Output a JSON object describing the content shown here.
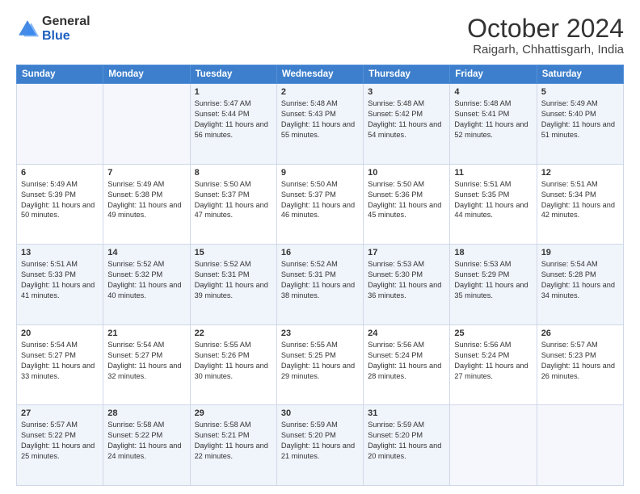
{
  "logo": {
    "general": "General",
    "blue": "Blue"
  },
  "header": {
    "month": "October 2024",
    "location": "Raigarh, Chhattisgarh, India"
  },
  "weekdays": [
    "Sunday",
    "Monday",
    "Tuesday",
    "Wednesday",
    "Thursday",
    "Friday",
    "Saturday"
  ],
  "weeks": [
    [
      {
        "day": "",
        "empty": true
      },
      {
        "day": "",
        "empty": true
      },
      {
        "day": "1",
        "sunrise": "Sunrise: 5:47 AM",
        "sunset": "Sunset: 5:44 PM",
        "daylight": "Daylight: 11 hours and 56 minutes."
      },
      {
        "day": "2",
        "sunrise": "Sunrise: 5:48 AM",
        "sunset": "Sunset: 5:43 PM",
        "daylight": "Daylight: 11 hours and 55 minutes."
      },
      {
        "day": "3",
        "sunrise": "Sunrise: 5:48 AM",
        "sunset": "Sunset: 5:42 PM",
        "daylight": "Daylight: 11 hours and 54 minutes."
      },
      {
        "day": "4",
        "sunrise": "Sunrise: 5:48 AM",
        "sunset": "Sunset: 5:41 PM",
        "daylight": "Daylight: 11 hours and 52 minutes."
      },
      {
        "day": "5",
        "sunrise": "Sunrise: 5:49 AM",
        "sunset": "Sunset: 5:40 PM",
        "daylight": "Daylight: 11 hours and 51 minutes."
      }
    ],
    [
      {
        "day": "6",
        "sunrise": "Sunrise: 5:49 AM",
        "sunset": "Sunset: 5:39 PM",
        "daylight": "Daylight: 11 hours and 50 minutes."
      },
      {
        "day": "7",
        "sunrise": "Sunrise: 5:49 AM",
        "sunset": "Sunset: 5:38 PM",
        "daylight": "Daylight: 11 hours and 49 minutes."
      },
      {
        "day": "8",
        "sunrise": "Sunrise: 5:50 AM",
        "sunset": "Sunset: 5:37 PM",
        "daylight": "Daylight: 11 hours and 47 minutes."
      },
      {
        "day": "9",
        "sunrise": "Sunrise: 5:50 AM",
        "sunset": "Sunset: 5:37 PM",
        "daylight": "Daylight: 11 hours and 46 minutes."
      },
      {
        "day": "10",
        "sunrise": "Sunrise: 5:50 AM",
        "sunset": "Sunset: 5:36 PM",
        "daylight": "Daylight: 11 hours and 45 minutes."
      },
      {
        "day": "11",
        "sunrise": "Sunrise: 5:51 AM",
        "sunset": "Sunset: 5:35 PM",
        "daylight": "Daylight: 11 hours and 44 minutes."
      },
      {
        "day": "12",
        "sunrise": "Sunrise: 5:51 AM",
        "sunset": "Sunset: 5:34 PM",
        "daylight": "Daylight: 11 hours and 42 minutes."
      }
    ],
    [
      {
        "day": "13",
        "sunrise": "Sunrise: 5:51 AM",
        "sunset": "Sunset: 5:33 PM",
        "daylight": "Daylight: 11 hours and 41 minutes."
      },
      {
        "day": "14",
        "sunrise": "Sunrise: 5:52 AM",
        "sunset": "Sunset: 5:32 PM",
        "daylight": "Daylight: 11 hours and 40 minutes."
      },
      {
        "day": "15",
        "sunrise": "Sunrise: 5:52 AM",
        "sunset": "Sunset: 5:31 PM",
        "daylight": "Daylight: 11 hours and 39 minutes."
      },
      {
        "day": "16",
        "sunrise": "Sunrise: 5:52 AM",
        "sunset": "Sunset: 5:31 PM",
        "daylight": "Daylight: 11 hours and 38 minutes."
      },
      {
        "day": "17",
        "sunrise": "Sunrise: 5:53 AM",
        "sunset": "Sunset: 5:30 PM",
        "daylight": "Daylight: 11 hours and 36 minutes."
      },
      {
        "day": "18",
        "sunrise": "Sunrise: 5:53 AM",
        "sunset": "Sunset: 5:29 PM",
        "daylight": "Daylight: 11 hours and 35 minutes."
      },
      {
        "day": "19",
        "sunrise": "Sunrise: 5:54 AM",
        "sunset": "Sunset: 5:28 PM",
        "daylight": "Daylight: 11 hours and 34 minutes."
      }
    ],
    [
      {
        "day": "20",
        "sunrise": "Sunrise: 5:54 AM",
        "sunset": "Sunset: 5:27 PM",
        "daylight": "Daylight: 11 hours and 33 minutes."
      },
      {
        "day": "21",
        "sunrise": "Sunrise: 5:54 AM",
        "sunset": "Sunset: 5:27 PM",
        "daylight": "Daylight: 11 hours and 32 minutes."
      },
      {
        "day": "22",
        "sunrise": "Sunrise: 5:55 AM",
        "sunset": "Sunset: 5:26 PM",
        "daylight": "Daylight: 11 hours and 30 minutes."
      },
      {
        "day": "23",
        "sunrise": "Sunrise: 5:55 AM",
        "sunset": "Sunset: 5:25 PM",
        "daylight": "Daylight: 11 hours and 29 minutes."
      },
      {
        "day": "24",
        "sunrise": "Sunrise: 5:56 AM",
        "sunset": "Sunset: 5:24 PM",
        "daylight": "Daylight: 11 hours and 28 minutes."
      },
      {
        "day": "25",
        "sunrise": "Sunrise: 5:56 AM",
        "sunset": "Sunset: 5:24 PM",
        "daylight": "Daylight: 11 hours and 27 minutes."
      },
      {
        "day": "26",
        "sunrise": "Sunrise: 5:57 AM",
        "sunset": "Sunset: 5:23 PM",
        "daylight": "Daylight: 11 hours and 26 minutes."
      }
    ],
    [
      {
        "day": "27",
        "sunrise": "Sunrise: 5:57 AM",
        "sunset": "Sunset: 5:22 PM",
        "daylight": "Daylight: 11 hours and 25 minutes."
      },
      {
        "day": "28",
        "sunrise": "Sunrise: 5:58 AM",
        "sunset": "Sunset: 5:22 PM",
        "daylight": "Daylight: 11 hours and 24 minutes."
      },
      {
        "day": "29",
        "sunrise": "Sunrise: 5:58 AM",
        "sunset": "Sunset: 5:21 PM",
        "daylight": "Daylight: 11 hours and 22 minutes."
      },
      {
        "day": "30",
        "sunrise": "Sunrise: 5:59 AM",
        "sunset": "Sunset: 5:20 PM",
        "daylight": "Daylight: 11 hours and 21 minutes."
      },
      {
        "day": "31",
        "sunrise": "Sunrise: 5:59 AM",
        "sunset": "Sunset: 5:20 PM",
        "daylight": "Daylight: 11 hours and 20 minutes."
      },
      {
        "day": "",
        "empty": true
      },
      {
        "day": "",
        "empty": true
      }
    ]
  ]
}
